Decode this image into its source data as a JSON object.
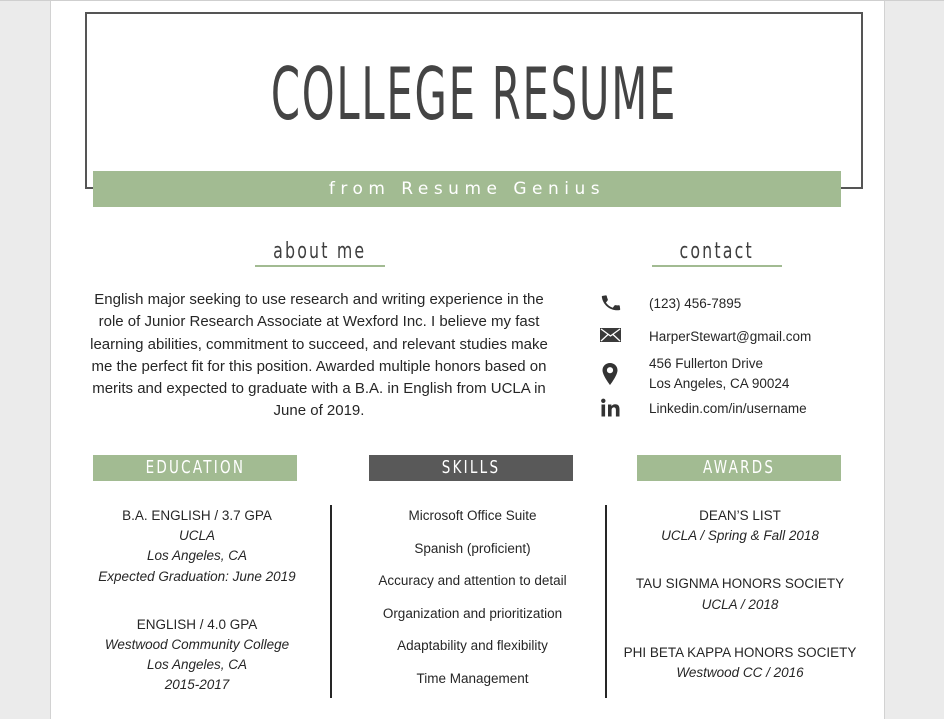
{
  "header": {
    "title": "COLLEGE RESUME",
    "subtitle": "from Resume Genius"
  },
  "about": {
    "heading": "about me",
    "text": "English major seeking to use research and writing experience in the role of Junior Research Associate at Wexford Inc. I believe my fast learning abilities, commitment to succeed, and relevant studies make me the perfect fit for this position. Awarded multiple honors based on merits and expected to graduate with a B.A. in English from UCLA in June of 2019."
  },
  "contact": {
    "heading": "contact",
    "items": [
      {
        "icon": "phone-icon",
        "lines": [
          "(123) 456-7895"
        ]
      },
      {
        "icon": "envelope-icon",
        "lines": [
          "HarperStewart@gmail.com"
        ]
      },
      {
        "icon": "map-pin-icon",
        "lines": [
          "456 Fullerton Drive",
          "Los Angeles, CA 90024"
        ]
      },
      {
        "icon": "linkedin-icon",
        "lines": [
          "Linkedin.com/in/username"
        ]
      }
    ]
  },
  "education": {
    "heading": "EDUCATION",
    "entries": [
      {
        "degree": "B.A. ENGLISH / 3.7 GPA",
        "school": "UCLA",
        "location": "Los Angeles, CA",
        "date": "Expected Graduation: June 2019"
      },
      {
        "degree": "ENGLISH / 4.0 GPA",
        "school": "Westwood Community College",
        "location": "Los Angeles, CA",
        "date": "2015-2017"
      }
    ]
  },
  "skills": {
    "heading": "SKILLS",
    "items": [
      "Microsoft Office Suite",
      "Spanish (proficient)",
      "Accuracy and attention to detail",
      "Organization and prioritization",
      "Adaptability and flexibility",
      "Time Management"
    ]
  },
  "awards": {
    "heading": "AWARDS",
    "entries": [
      {
        "name": "DEAN’S LIST",
        "detail": "UCLA / Spring & Fall 2018"
      },
      {
        "name": "TAU SIGNMA HONORS SOCIETY",
        "detail": "UCLA / 2018"
      },
      {
        "name": "PHI BETA KAPPA HONORS SOCIETY",
        "detail": "Westwood CC / 2016"
      }
    ]
  },
  "colors": {
    "accent_green": "#a2bb92",
    "dark_band": "#595959",
    "text": "#262626",
    "title": "#444444"
  }
}
